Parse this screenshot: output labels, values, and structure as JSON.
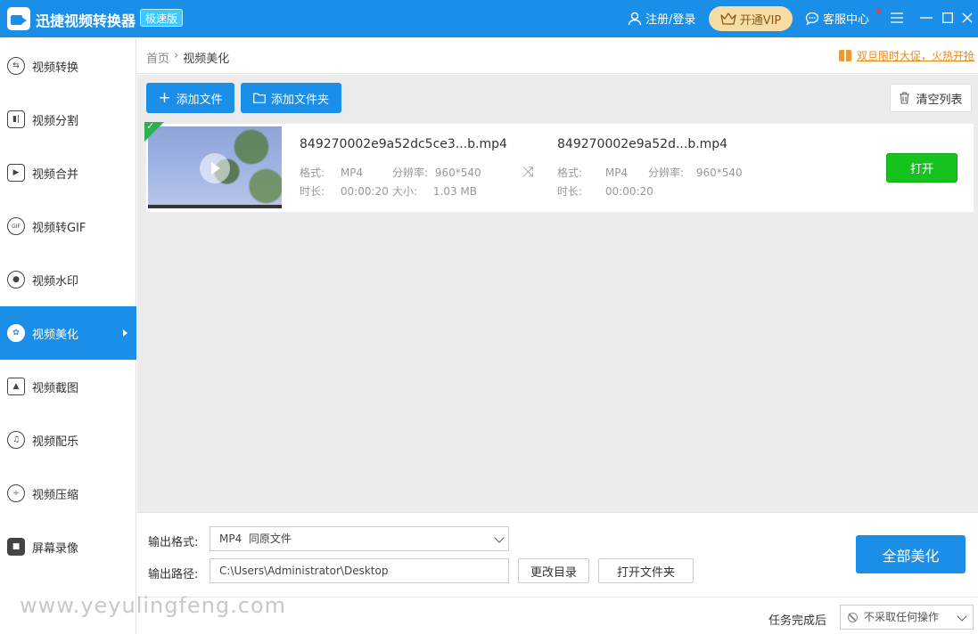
{
  "app": {
    "title": "迅捷视频转换器",
    "edition": "极速版",
    "login": "注册/登录",
    "vip": "开通VIP",
    "service": "客服中心"
  },
  "sidebar": {
    "items": [
      {
        "label": "视频转换",
        "icon": "convert-icon"
      },
      {
        "label": "视频分割",
        "icon": "split-icon"
      },
      {
        "label": "视频合并",
        "icon": "merge-icon"
      },
      {
        "label": "视频转GIF",
        "icon": "gif-icon"
      },
      {
        "label": "视频水印",
        "icon": "watermark-icon"
      },
      {
        "label": "视频美化",
        "icon": "beautify-icon",
        "active": true
      },
      {
        "label": "视频截图",
        "icon": "screenshot-icon"
      },
      {
        "label": "视频配乐",
        "icon": "music-icon"
      },
      {
        "label": "视频压缩",
        "icon": "compress-icon"
      },
      {
        "label": "屏幕录像",
        "icon": "record-icon"
      }
    ]
  },
  "breadcrumb": {
    "home": "首页",
    "current": "视频美化"
  },
  "promo": "双旦限时大促，火热开抢",
  "toolbar": {
    "add_file": "添加文件",
    "add_folder": "添加文件夹",
    "clear_list": "清空列表"
  },
  "file": {
    "source": {
      "name": "849270002e9a52dc5ce3...b.mp4",
      "format_label": "格式:",
      "format": "MP4",
      "resolution_label": "分辨率:",
      "resolution": "960*540",
      "duration_label": "时长:",
      "duration": "00:00:20",
      "size_label": "大小:",
      "size": "1.03 MB"
    },
    "output": {
      "name": "849270002e9a52d...b.mp4",
      "format_label": "格式:",
      "format": "MP4",
      "resolution_label": "分辨率:",
      "resolution": "960*540",
      "duration_label": "时长:",
      "duration": "00:00:20"
    },
    "open": "打开"
  },
  "output": {
    "format_label": "输出格式:",
    "format_value": "MP4  同原文件",
    "path_label": "输出路径:",
    "path_value": "C:\\Users\\Administrator\\Desktop",
    "change_dir": "更改目录",
    "open_folder": "打开文件夹",
    "beautify_all": "全部美化"
  },
  "status": {
    "after_label": "任务完成后",
    "after_value": "不采取任何操作"
  },
  "watermark": "www.yeyulingfeng.com",
  "colors": {
    "primary": "#1b8fe8",
    "open_green": "#16c21e",
    "promo_orange": "#e88a19",
    "vip_gold": "#f7dca3"
  }
}
